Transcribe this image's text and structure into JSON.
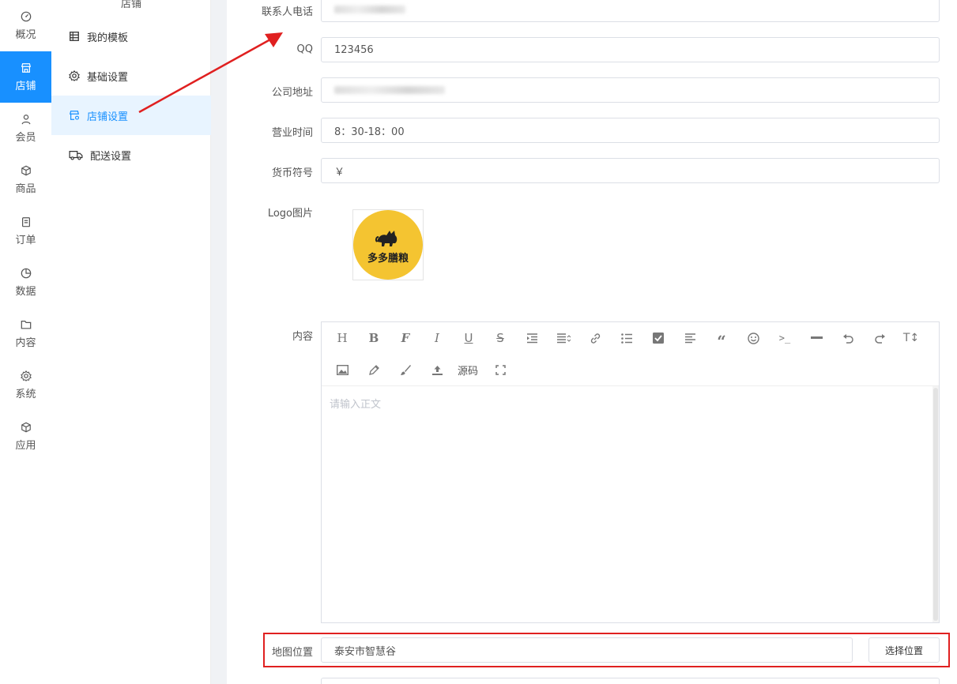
{
  "rail": {
    "items": [
      {
        "label": "概况",
        "icon": "dashboard-icon"
      },
      {
        "label": "店铺",
        "icon": "store-icon"
      },
      {
        "label": "会员",
        "icon": "user-icon"
      },
      {
        "label": "商品",
        "icon": "box-icon"
      },
      {
        "label": "订单",
        "icon": "order-icon"
      },
      {
        "label": "数据",
        "icon": "pie-chart-icon"
      },
      {
        "label": "内容",
        "icon": "folder-icon"
      },
      {
        "label": "系统",
        "icon": "gear-icon"
      },
      {
        "label": "应用",
        "icon": "cube-icon"
      }
    ],
    "active_color": "#1890ff"
  },
  "submenu": {
    "title": "店铺",
    "items": [
      {
        "label": "我的模板",
        "icon": "table-icon"
      },
      {
        "label": "基础设置",
        "icon": "gear-icon"
      },
      {
        "label": "店铺设置",
        "icon": "store-settings-icon"
      },
      {
        "label": "配送设置",
        "icon": "truck-icon"
      }
    ]
  },
  "form": {
    "contact_phone": {
      "label": "联系人电话"
    },
    "qq": {
      "label": "QQ",
      "value": "123456"
    },
    "address": {
      "label": "公司地址"
    },
    "hours": {
      "label": "营业时间",
      "value": "8：30-18：00"
    },
    "currency": {
      "label": "货币符号",
      "value": "￥"
    },
    "logo": {
      "label": "Logo图片",
      "text": "多多膳粮"
    },
    "content": {
      "label": "内容",
      "placeholder": "请输入正文",
      "source_label": "源码"
    },
    "map": {
      "label": "地图位置",
      "value": "泰安市智慧谷",
      "button": "选择位置"
    }
  },
  "toolbar": {
    "row1": [
      "heading-icon",
      "bold-icon",
      "font-icon",
      "italic-icon",
      "underline-icon",
      "strikethrough-icon",
      "indent-icon",
      "align-icon",
      "link-icon",
      "list-icon",
      "checkbox-icon",
      "justify-icon",
      "quote-icon",
      "emoji-icon",
      "code-icon",
      "hr-icon",
      "undo-icon",
      "redo-icon",
      "text-height-icon"
    ],
    "row2": [
      "image-icon",
      "pen-icon",
      "brush-icon",
      "upload-icon",
      "fullscreen-icon"
    ]
  },
  "annotation": {
    "color": "#e02020"
  }
}
